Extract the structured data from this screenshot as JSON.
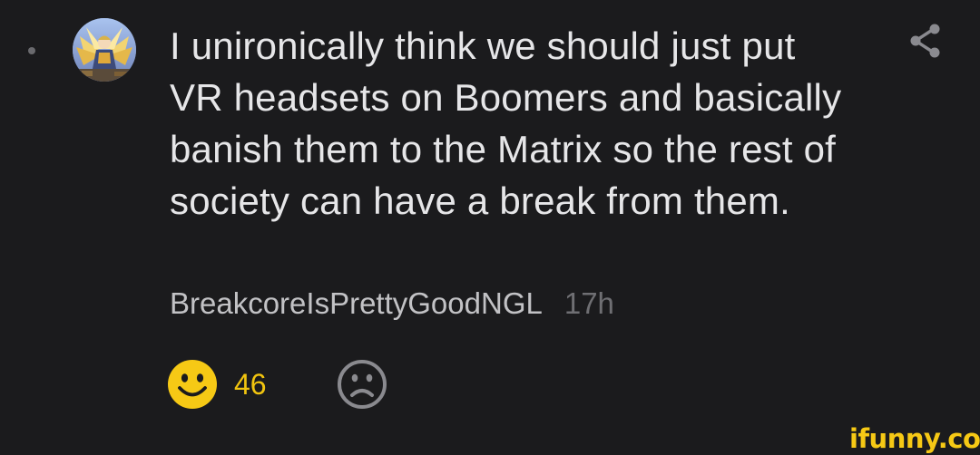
{
  "comment": {
    "text": "I unironically think we should just put VR headsets on Boomers and basically banish them to the Matrix so the rest of society can have a break from them.",
    "username": "BreakcoreIsPrettyGoodNGL",
    "time_ago": "17h"
  },
  "reactions": {
    "like_count": "46",
    "like_icon": "smile-icon",
    "dislike_icon": "frown-icon"
  },
  "actions": {
    "share_icon": "share-icon"
  },
  "watermark": {
    "text": "ifunny.co"
  },
  "colors": {
    "background": "#1b1b1d",
    "text": "#e6e6e8",
    "username": "#c2c2c5",
    "timestamp": "#6f6f73",
    "accent_yellow": "#f1c40f",
    "icon_gray": "#8a8a8f",
    "online_dot": "#6a6a6e"
  }
}
